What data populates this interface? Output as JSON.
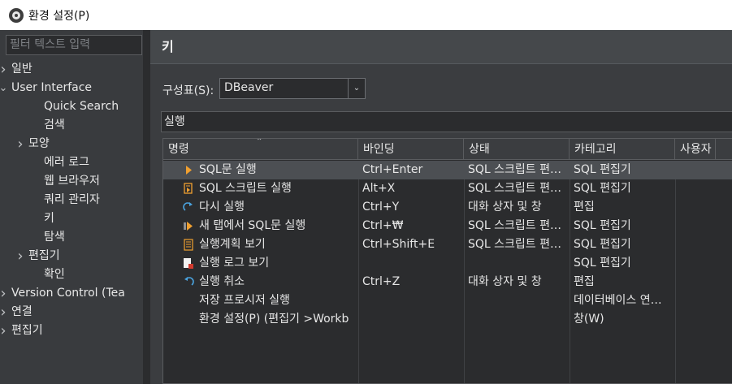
{
  "window": {
    "title": "환경 설정(P)"
  },
  "sidebar": {
    "filter_placeholder": "필터 텍스트 입력",
    "items": [
      {
        "label": "일반",
        "level": 0,
        "arrow": "collapsed"
      },
      {
        "label": "User Interface",
        "level": 0,
        "arrow": "expanded"
      },
      {
        "label": "Quick Search",
        "level": 2,
        "arrow": "none"
      },
      {
        "label": "검색",
        "level": 2,
        "arrow": "none"
      },
      {
        "label": "모양",
        "level": 1,
        "arrow": "collapsed"
      },
      {
        "label": "에러 로그",
        "level": 2,
        "arrow": "none"
      },
      {
        "label": "웹 브라우저",
        "level": 2,
        "arrow": "none"
      },
      {
        "label": "쿼리 관리자",
        "level": 2,
        "arrow": "none"
      },
      {
        "label": "키",
        "level": 2,
        "arrow": "none"
      },
      {
        "label": "탐색",
        "level": 2,
        "arrow": "none"
      },
      {
        "label": "편집기",
        "level": 1,
        "arrow": "collapsed"
      },
      {
        "label": "확인",
        "level": 2,
        "arrow": "none"
      },
      {
        "label": "Version Control (Tea",
        "level": 0,
        "arrow": "collapsed"
      },
      {
        "label": "연결",
        "level": 0,
        "arrow": "collapsed"
      },
      {
        "label": "편집기",
        "level": 0,
        "arrow": "collapsed"
      }
    ]
  },
  "page": {
    "title": "키"
  },
  "scheme": {
    "label": "구성표(S):",
    "value": "DBeaver"
  },
  "search": {
    "value": "실행"
  },
  "table": {
    "columns": [
      "명령",
      "바인딩",
      "상태",
      "카테고리",
      "사용자"
    ],
    "rows": [
      {
        "icon": "run-arrow-icon",
        "command": "SQL문 실행",
        "binding": "Ctrl+Enter",
        "status": "SQL 스크립트 편…",
        "category": "SQL 편집기",
        "selected": true
      },
      {
        "icon": "run-script-icon",
        "command": "SQL 스크립트 실행",
        "binding": "Alt+X",
        "status": "SQL 스크립트 편…",
        "category": "SQL 편집기",
        "selected": false
      },
      {
        "icon": "redo-icon",
        "command": "다시 실행",
        "binding": "Ctrl+Y",
        "status": "대화 상자 및 창",
        "category": "편집",
        "selected": false
      },
      {
        "icon": "run-new-tab-icon",
        "command": "새 탭에서 SQL문 실행",
        "binding": "Ctrl+₩",
        "status": "SQL 스크립트 편…",
        "category": "SQL 편집기",
        "selected": false
      },
      {
        "icon": "explain-plan-icon",
        "command": "실행계획 보기",
        "binding": "Ctrl+Shift+E",
        "status": "SQL 스크립트 편…",
        "category": "SQL 편집기",
        "selected": false
      },
      {
        "icon": "execution-log-icon",
        "command": "실행 로그 보기",
        "binding": "",
        "status": "",
        "category": "SQL 편집기",
        "selected": false
      },
      {
        "icon": "undo-icon",
        "command": "실행 취소",
        "binding": "Ctrl+Z",
        "status": "대화 상자 및 창",
        "category": "편집",
        "selected": false
      },
      {
        "icon": "",
        "command": "저장 프로시저 실행",
        "binding": "",
        "status": "",
        "category": "데이터베이스 연…",
        "selected": false
      },
      {
        "icon": "",
        "command": "환경 설정(P) (편집기 >Workb",
        "binding": "",
        "status": "",
        "category": "창(W)",
        "selected": false
      }
    ]
  },
  "colors": {
    "background": "#2f3134",
    "panel": "#3b3d40",
    "input": "#2b2c2e",
    "selection": "#4c4f53",
    "run_icon": "#f0a030",
    "redo_icon": "#4aa3df"
  }
}
